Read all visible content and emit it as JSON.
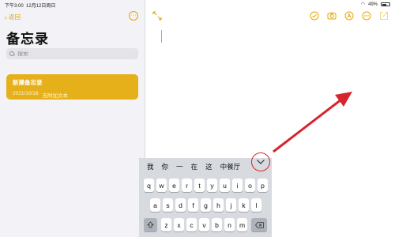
{
  "status_bar": {
    "time": "下午3:00",
    "date": "12月12日周日",
    "battery": "49%"
  },
  "sidebar": {
    "back_label": "返回",
    "title": "备忘录",
    "search_placeholder": "搜索",
    "notes": [
      {
        "title": "新建备忘录",
        "date": "2021/10/16",
        "preview": "无附加文本"
      }
    ]
  },
  "editor": {
    "toolbar_icons": [
      "checklist-icon",
      "camera-icon",
      "markup-icon",
      "more-icon",
      "share-icon"
    ]
  },
  "keyboard": {
    "candidates": [
      "我",
      "你",
      "一",
      "在",
      "这",
      "中餐厅"
    ],
    "row1": [
      "q",
      "w",
      "e",
      "r",
      "t",
      "y",
      "u",
      "i",
      "o",
      "p"
    ],
    "row2": [
      "a",
      "s",
      "d",
      "f",
      "g",
      "h",
      "j",
      "k",
      "l"
    ],
    "row3": [
      "z",
      "x",
      "c",
      "v",
      "b",
      "n",
      "m"
    ]
  },
  "colors": {
    "accent": "#e6a500",
    "note_selected": "#e6b01a",
    "annotation": "#d6262d"
  }
}
